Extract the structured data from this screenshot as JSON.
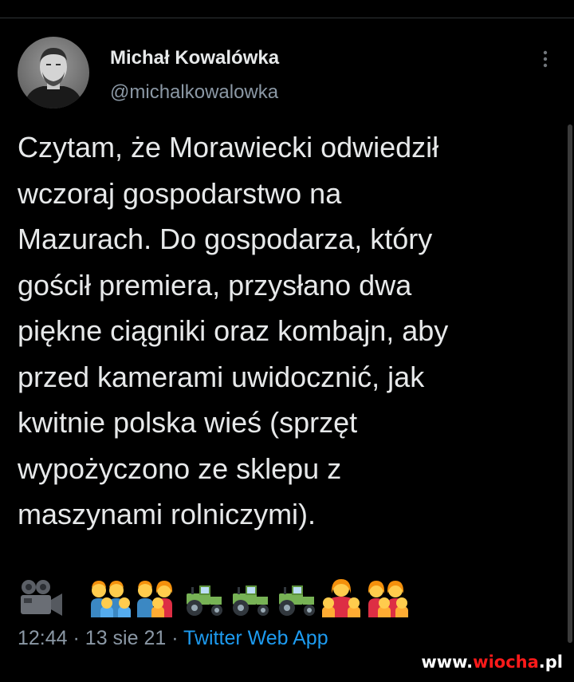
{
  "tweet": {
    "author": {
      "name": "Michał Kowalówka",
      "handle": "@michalkowalowka",
      "avatar_icon": "profile-photo"
    },
    "more_icon": "more-vertical-icon",
    "text_lines": [
      "Czytam, że Morawiecki odwiedził",
      "wczoraj gospodarstwo na",
      "Mazurach. Do gospodarza, który",
      "gościł premiera, przysłano dwa",
      "piękne ciągniki oraz kombajn, aby",
      "przed kamerami uwidocznić, jak",
      "kwitnie polska wieś (sprzęt",
      "wypożyczono ze sklepu z",
      "maszynami rolniczymi)."
    ],
    "emoji_row": [
      "movie-camera-icon",
      "family-icon",
      "family-icon",
      "tractor-icon",
      "tractor-icon",
      "tractor-icon",
      "family-icon",
      "family-icon"
    ],
    "meta": {
      "time": "12:44",
      "separator": "·",
      "date": "13 sie 21",
      "source": "Twitter Web App"
    }
  },
  "watermark": {
    "prefix": "www.",
    "brand": "wiocha",
    "suffix": ".pl"
  },
  "colors": {
    "background": "#000000",
    "text_primary": "#e7e9ea",
    "text_secondary": "#8b98a5",
    "link": "#1d9bf0",
    "watermark_accent": "#ff1a1a"
  }
}
